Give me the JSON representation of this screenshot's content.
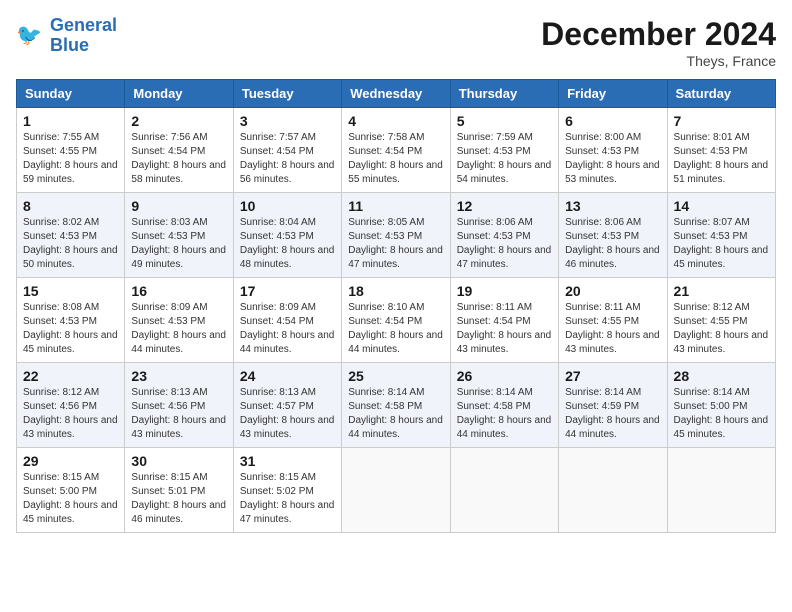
{
  "header": {
    "logo_line1": "General",
    "logo_line2": "Blue",
    "month_title": "December 2024",
    "location": "Theys, France"
  },
  "columns": [
    "Sunday",
    "Monday",
    "Tuesday",
    "Wednesday",
    "Thursday",
    "Friday",
    "Saturday"
  ],
  "weeks": [
    [
      {
        "day": "1",
        "sunrise": "7:55 AM",
        "sunset": "4:55 PM",
        "daylight": "8 hours and 59 minutes."
      },
      {
        "day": "2",
        "sunrise": "7:56 AM",
        "sunset": "4:54 PM",
        "daylight": "8 hours and 58 minutes."
      },
      {
        "day": "3",
        "sunrise": "7:57 AM",
        "sunset": "4:54 PM",
        "daylight": "8 hours and 56 minutes."
      },
      {
        "day": "4",
        "sunrise": "7:58 AM",
        "sunset": "4:54 PM",
        "daylight": "8 hours and 55 minutes."
      },
      {
        "day": "5",
        "sunrise": "7:59 AM",
        "sunset": "4:53 PM",
        "daylight": "8 hours and 54 minutes."
      },
      {
        "day": "6",
        "sunrise": "8:00 AM",
        "sunset": "4:53 PM",
        "daylight": "8 hours and 53 minutes."
      },
      {
        "day": "7",
        "sunrise": "8:01 AM",
        "sunset": "4:53 PM",
        "daylight": "8 hours and 51 minutes."
      }
    ],
    [
      {
        "day": "8",
        "sunrise": "8:02 AM",
        "sunset": "4:53 PM",
        "daylight": "8 hours and 50 minutes."
      },
      {
        "day": "9",
        "sunrise": "8:03 AM",
        "sunset": "4:53 PM",
        "daylight": "8 hours and 49 minutes."
      },
      {
        "day": "10",
        "sunrise": "8:04 AM",
        "sunset": "4:53 PM",
        "daylight": "8 hours and 48 minutes."
      },
      {
        "day": "11",
        "sunrise": "8:05 AM",
        "sunset": "4:53 PM",
        "daylight": "8 hours and 47 minutes."
      },
      {
        "day": "12",
        "sunrise": "8:06 AM",
        "sunset": "4:53 PM",
        "daylight": "8 hours and 47 minutes."
      },
      {
        "day": "13",
        "sunrise": "8:06 AM",
        "sunset": "4:53 PM",
        "daylight": "8 hours and 46 minutes."
      },
      {
        "day": "14",
        "sunrise": "8:07 AM",
        "sunset": "4:53 PM",
        "daylight": "8 hours and 45 minutes."
      }
    ],
    [
      {
        "day": "15",
        "sunrise": "8:08 AM",
        "sunset": "4:53 PM",
        "daylight": "8 hours and 45 minutes."
      },
      {
        "day": "16",
        "sunrise": "8:09 AM",
        "sunset": "4:53 PM",
        "daylight": "8 hours and 44 minutes."
      },
      {
        "day": "17",
        "sunrise": "8:09 AM",
        "sunset": "4:54 PM",
        "daylight": "8 hours and 44 minutes."
      },
      {
        "day": "18",
        "sunrise": "8:10 AM",
        "sunset": "4:54 PM",
        "daylight": "8 hours and 44 minutes."
      },
      {
        "day": "19",
        "sunrise": "8:11 AM",
        "sunset": "4:54 PM",
        "daylight": "8 hours and 43 minutes."
      },
      {
        "day": "20",
        "sunrise": "8:11 AM",
        "sunset": "4:55 PM",
        "daylight": "8 hours and 43 minutes."
      },
      {
        "day": "21",
        "sunrise": "8:12 AM",
        "sunset": "4:55 PM",
        "daylight": "8 hours and 43 minutes."
      }
    ],
    [
      {
        "day": "22",
        "sunrise": "8:12 AM",
        "sunset": "4:56 PM",
        "daylight": "8 hours and 43 minutes."
      },
      {
        "day": "23",
        "sunrise": "8:13 AM",
        "sunset": "4:56 PM",
        "daylight": "8 hours and 43 minutes."
      },
      {
        "day": "24",
        "sunrise": "8:13 AM",
        "sunset": "4:57 PM",
        "daylight": "8 hours and 43 minutes."
      },
      {
        "day": "25",
        "sunrise": "8:14 AM",
        "sunset": "4:58 PM",
        "daylight": "8 hours and 44 minutes."
      },
      {
        "day": "26",
        "sunrise": "8:14 AM",
        "sunset": "4:58 PM",
        "daylight": "8 hours and 44 minutes."
      },
      {
        "day": "27",
        "sunrise": "8:14 AM",
        "sunset": "4:59 PM",
        "daylight": "8 hours and 44 minutes."
      },
      {
        "day": "28",
        "sunrise": "8:14 AM",
        "sunset": "5:00 PM",
        "daylight": "8 hours and 45 minutes."
      }
    ],
    [
      {
        "day": "29",
        "sunrise": "8:15 AM",
        "sunset": "5:00 PM",
        "daylight": "8 hours and 45 minutes."
      },
      {
        "day": "30",
        "sunrise": "8:15 AM",
        "sunset": "5:01 PM",
        "daylight": "8 hours and 46 minutes."
      },
      {
        "day": "31",
        "sunrise": "8:15 AM",
        "sunset": "5:02 PM",
        "daylight": "8 hours and 47 minutes."
      },
      null,
      null,
      null,
      null
    ]
  ],
  "labels": {
    "sunrise": "Sunrise:",
    "sunset": "Sunset:",
    "daylight": "Daylight:"
  }
}
